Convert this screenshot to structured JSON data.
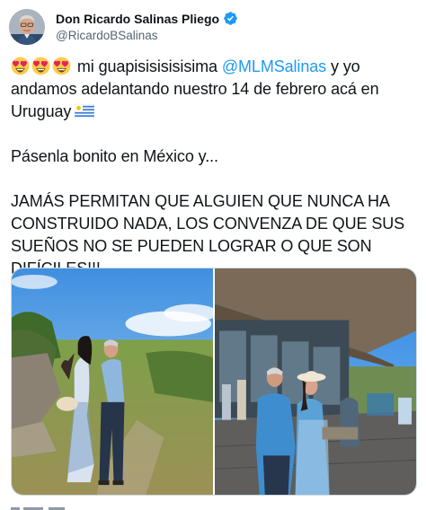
{
  "author": {
    "display_name": "Don Ricardo Salinas Pliego",
    "handle": "@RicardoBSalinas",
    "avatar_icon": "profile-photo",
    "verified_icon": "verified-badge-icon",
    "verified_color": "#1d9bf0"
  },
  "tweet": {
    "line1_pre": " mi guapisisisisisima ",
    "mention": "@MLMSalinas",
    "line1_post": " y yo andamos adelantando nuestro 14 de febrero acá en Uruguay",
    "paragraph2": "Pásenla bonito en México y...",
    "paragraph3": "JAMÁS PERMITAN QUE ALGUIEN QUE NUNCA HA CONSTRUIDO NADA, LOS CONVENZA DE QUE SUS SUEÑOS NO SE PUEDEN LOGRAR O QUE SON DIFÍCILES!!!",
    "emojis": [
      "heart-eyes-emoji",
      "heart-eyes-emoji",
      "heart-eyes-emoji"
    ],
    "flag_icon": "uruguay-flag-icon",
    "mention_color": "#1d9bf0"
  },
  "media": {
    "photos": [
      "couple-hillside-photo",
      "couple-terrace-photo"
    ]
  }
}
